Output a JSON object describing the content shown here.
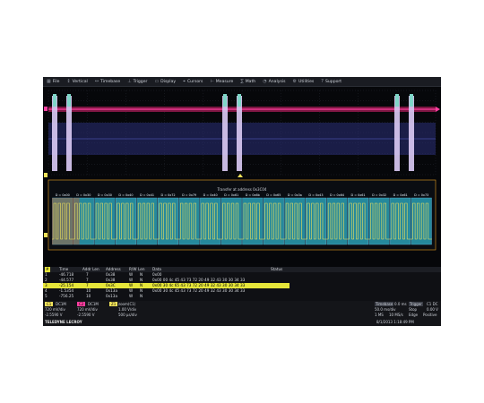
{
  "menu": {
    "items": [
      {
        "label": "File",
        "icon": "file-icon"
      },
      {
        "label": "Vertical",
        "icon": "vertical-icon"
      },
      {
        "label": "Timebase",
        "icon": "timebase-icon"
      },
      {
        "label": "Trigger",
        "icon": "trigger-icon"
      },
      {
        "label": "Display",
        "icon": "display-icon"
      },
      {
        "label": "Cursors",
        "icon": "cursors-icon"
      },
      {
        "label": "Measure",
        "icon": "measure-icon"
      },
      {
        "label": "Math",
        "icon": "math-icon"
      },
      {
        "label": "Analysis",
        "icon": "analysis-icon"
      },
      {
        "label": "Utilities",
        "icon": "utilities-icon"
      },
      {
        "label": "Support",
        "icon": "support-icon"
      }
    ]
  },
  "decode": {
    "banner": "Transfer at address 0x3C04",
    "segments": [
      "D = 0x00",
      "D = 0x30",
      "D = 0x30",
      "D = 0x40",
      "D = 0x41",
      "D = 0x72",
      "D = 0x79",
      "D = 0x40",
      "D = 0x61",
      "D = 0x6b",
      "D = 0x65",
      "D = 0x3a",
      "D = 0x43",
      "D = 0x64",
      "D = 0x61",
      "D = 0x32",
      "D = 0x61",
      "D = 0x73"
    ]
  },
  "table": {
    "headers": {
      "idx": "#",
      "time": "Time",
      "addr_len": "Addr Len",
      "address": "Address",
      "rw": "R/W",
      "len": "Len",
      "data": "Data",
      "status": "Status"
    },
    "rows": [
      {
        "idx": "1",
        "time": "-46.718",
        "addr_len": "7",
        "address": "0x38",
        "rw": "W",
        "len": "N",
        "data": "0x00"
      },
      {
        "idx": "2",
        "time": "-44.577",
        "addr_len": "7",
        "address": "0x38",
        "rw": "W",
        "len": "N",
        "data": "0x00 00 4c 45 43 73 72 20 49 32 43 30 30 34 33"
      },
      {
        "idx": "3",
        "time": "-25.154",
        "addr_len": "7",
        "address": "0x3C",
        "rw": "W",
        "len": "N",
        "data": "0x00 30 4c 65 43 73 72 20 49 32 43 30 30 34 33"
      },
      {
        "idx": "4",
        "time": "-1.5354",
        "addr_len": "10",
        "address": "0x13a",
        "rw": "W",
        "len": "N",
        "data": "0x00 30 4c 45 43 73 72 20 49 32 43 30 30 34 33"
      },
      {
        "idx": "5",
        "time": "-756.25",
        "addr_len": "10",
        "address": "0x13a",
        "rw": "W",
        "len": "N",
        "data": ""
      }
    ]
  },
  "bottom": {
    "c1": {
      "label": "C1",
      "coupling": "DC1M",
      "vdiv": "720 mV/div",
      "offset": "-2.5590 V"
    },
    "c2": {
      "label": "C2",
      "coupling": "DC1M",
      "vdiv": "720 mV/div",
      "offset": "-2.5590 V"
    },
    "z1": {
      "label": "Z1",
      "name": "zoom(C1)",
      "vdiv": "1.00 V/div",
      "timediv": "500 µs/div"
    },
    "timebase": {
      "label": "Timebase",
      "value": "0.0 ms",
      "rate1": "50.0 ms/div",
      "rate2": "1 MS",
      "rate3": "10 MS/s"
    },
    "trigger": {
      "label": "Trigger",
      "value": "C1 DC",
      "mode": "Stop",
      "level": "0.00 V",
      "type": "Edge",
      "slope": "Positive"
    },
    "brand": "TELEDYNE LECROY",
    "datetime": "8/1/2013 1:18:49 PM"
  },
  "colors": {
    "ch1": "#f0e25a",
    "ch2": "#ff3fa0",
    "decode_fill": "#2a9fb5",
    "burst": "#d8c8f2",
    "selected_row": "#e6e63a"
  }
}
